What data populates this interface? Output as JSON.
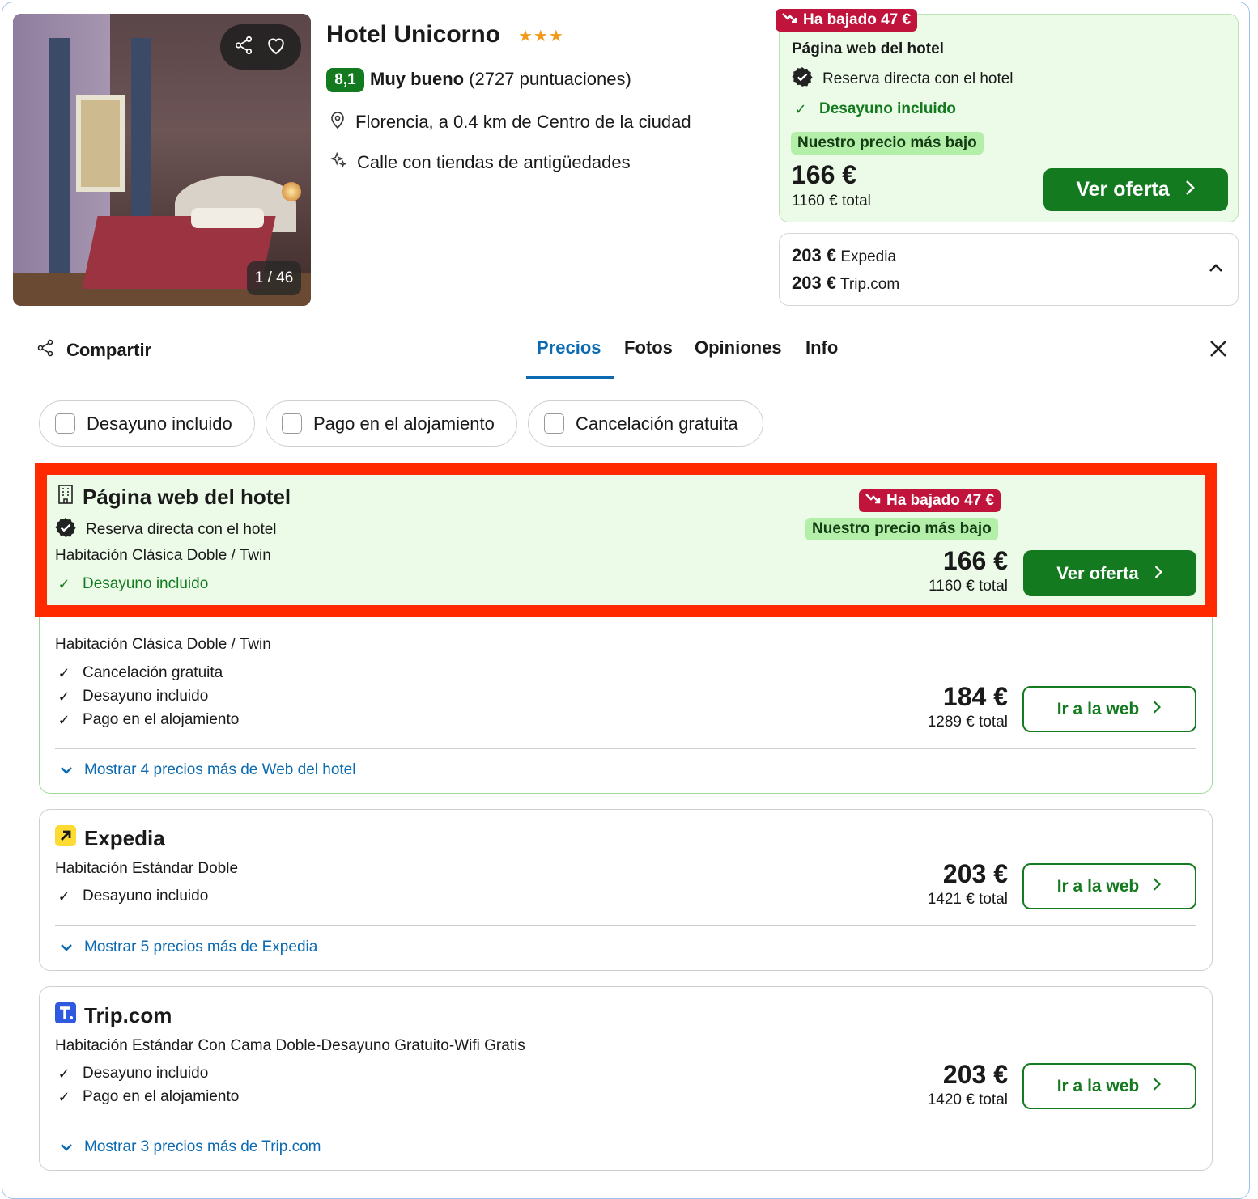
{
  "hotel": {
    "name": "Hotel Unicorno",
    "stars": "★★★",
    "score": "8,1",
    "rating_label": "Muy bueno",
    "rating_count": "(2727 puntuaciones)",
    "location": "Florencia, a 0.4 km de Centro de la ciudad",
    "feature": "Calle con tiendas de antigüedades",
    "photo_counter": "1 / 46"
  },
  "top_deal": {
    "drop_badge": "Ha bajado 47 €",
    "provider": "Página web del hotel",
    "direct": "Reserva directa con el hotel",
    "breakfast": "Desayuno incluido",
    "lowest": "Nuestro precio más bajo",
    "price": "166 €",
    "total": "1160 € total",
    "button": "Ver oferta"
  },
  "alt_prices": [
    {
      "price": "203 €",
      "provider": "Expedia"
    },
    {
      "price": "203 €",
      "provider": "Trip.com"
    }
  ],
  "nav": {
    "share": "Compartir",
    "tabs": [
      "Precios",
      "Fotos",
      "Opiniones",
      "Info"
    ]
  },
  "filters": [
    "Desayuno incluido",
    "Pago en el alojamiento",
    "Cancelación gratuita"
  ],
  "hotel_site": {
    "title": "Página web del hotel",
    "direct": "Reserva directa con el hotel",
    "room": "Habitación Clásica Doble / Twin",
    "breakfast": "Desayuno incluido",
    "drop_badge": "Ha bajado 47 €",
    "lowest": "Nuestro precio más bajo",
    "price": "166 €",
    "total": "1160 € total",
    "button": "Ver oferta",
    "second": {
      "room": "Habitación Clásica Doble / Twin",
      "features": [
        "Cancelación gratuita",
        "Desayuno incluido",
        "Pago en el alojamiento"
      ],
      "price": "184 €",
      "total": "1289 € total",
      "button": "Ir a la web"
    },
    "more": "Mostrar 4 precios más de Web del hotel"
  },
  "expedia": {
    "title": "Expedia",
    "room": "Habitación Estándar Doble",
    "features": [
      "Desayuno incluido"
    ],
    "price": "203 €",
    "total": "1421 € total",
    "button": "Ir a la web",
    "more": "Mostrar 5 precios más de Expedia"
  },
  "tripcom": {
    "title": "Trip.com",
    "room": "Habitación Estándar Con Cama Doble-Desayuno Gratuito-Wifi Gratis",
    "features": [
      "Desayuno incluido",
      "Pago en el alojamiento"
    ],
    "price": "203 €",
    "total": "1420 € total",
    "button": "Ir a la web",
    "more": "Mostrar 3 precios más de Trip.com"
  },
  "colors": {
    "accent_green": "#137a1f",
    "link_blue": "#0b6ab1",
    "drop_red": "#c0143c",
    "highlight_red": "#ff2a00",
    "deal_bg": "#ebfbe8"
  }
}
